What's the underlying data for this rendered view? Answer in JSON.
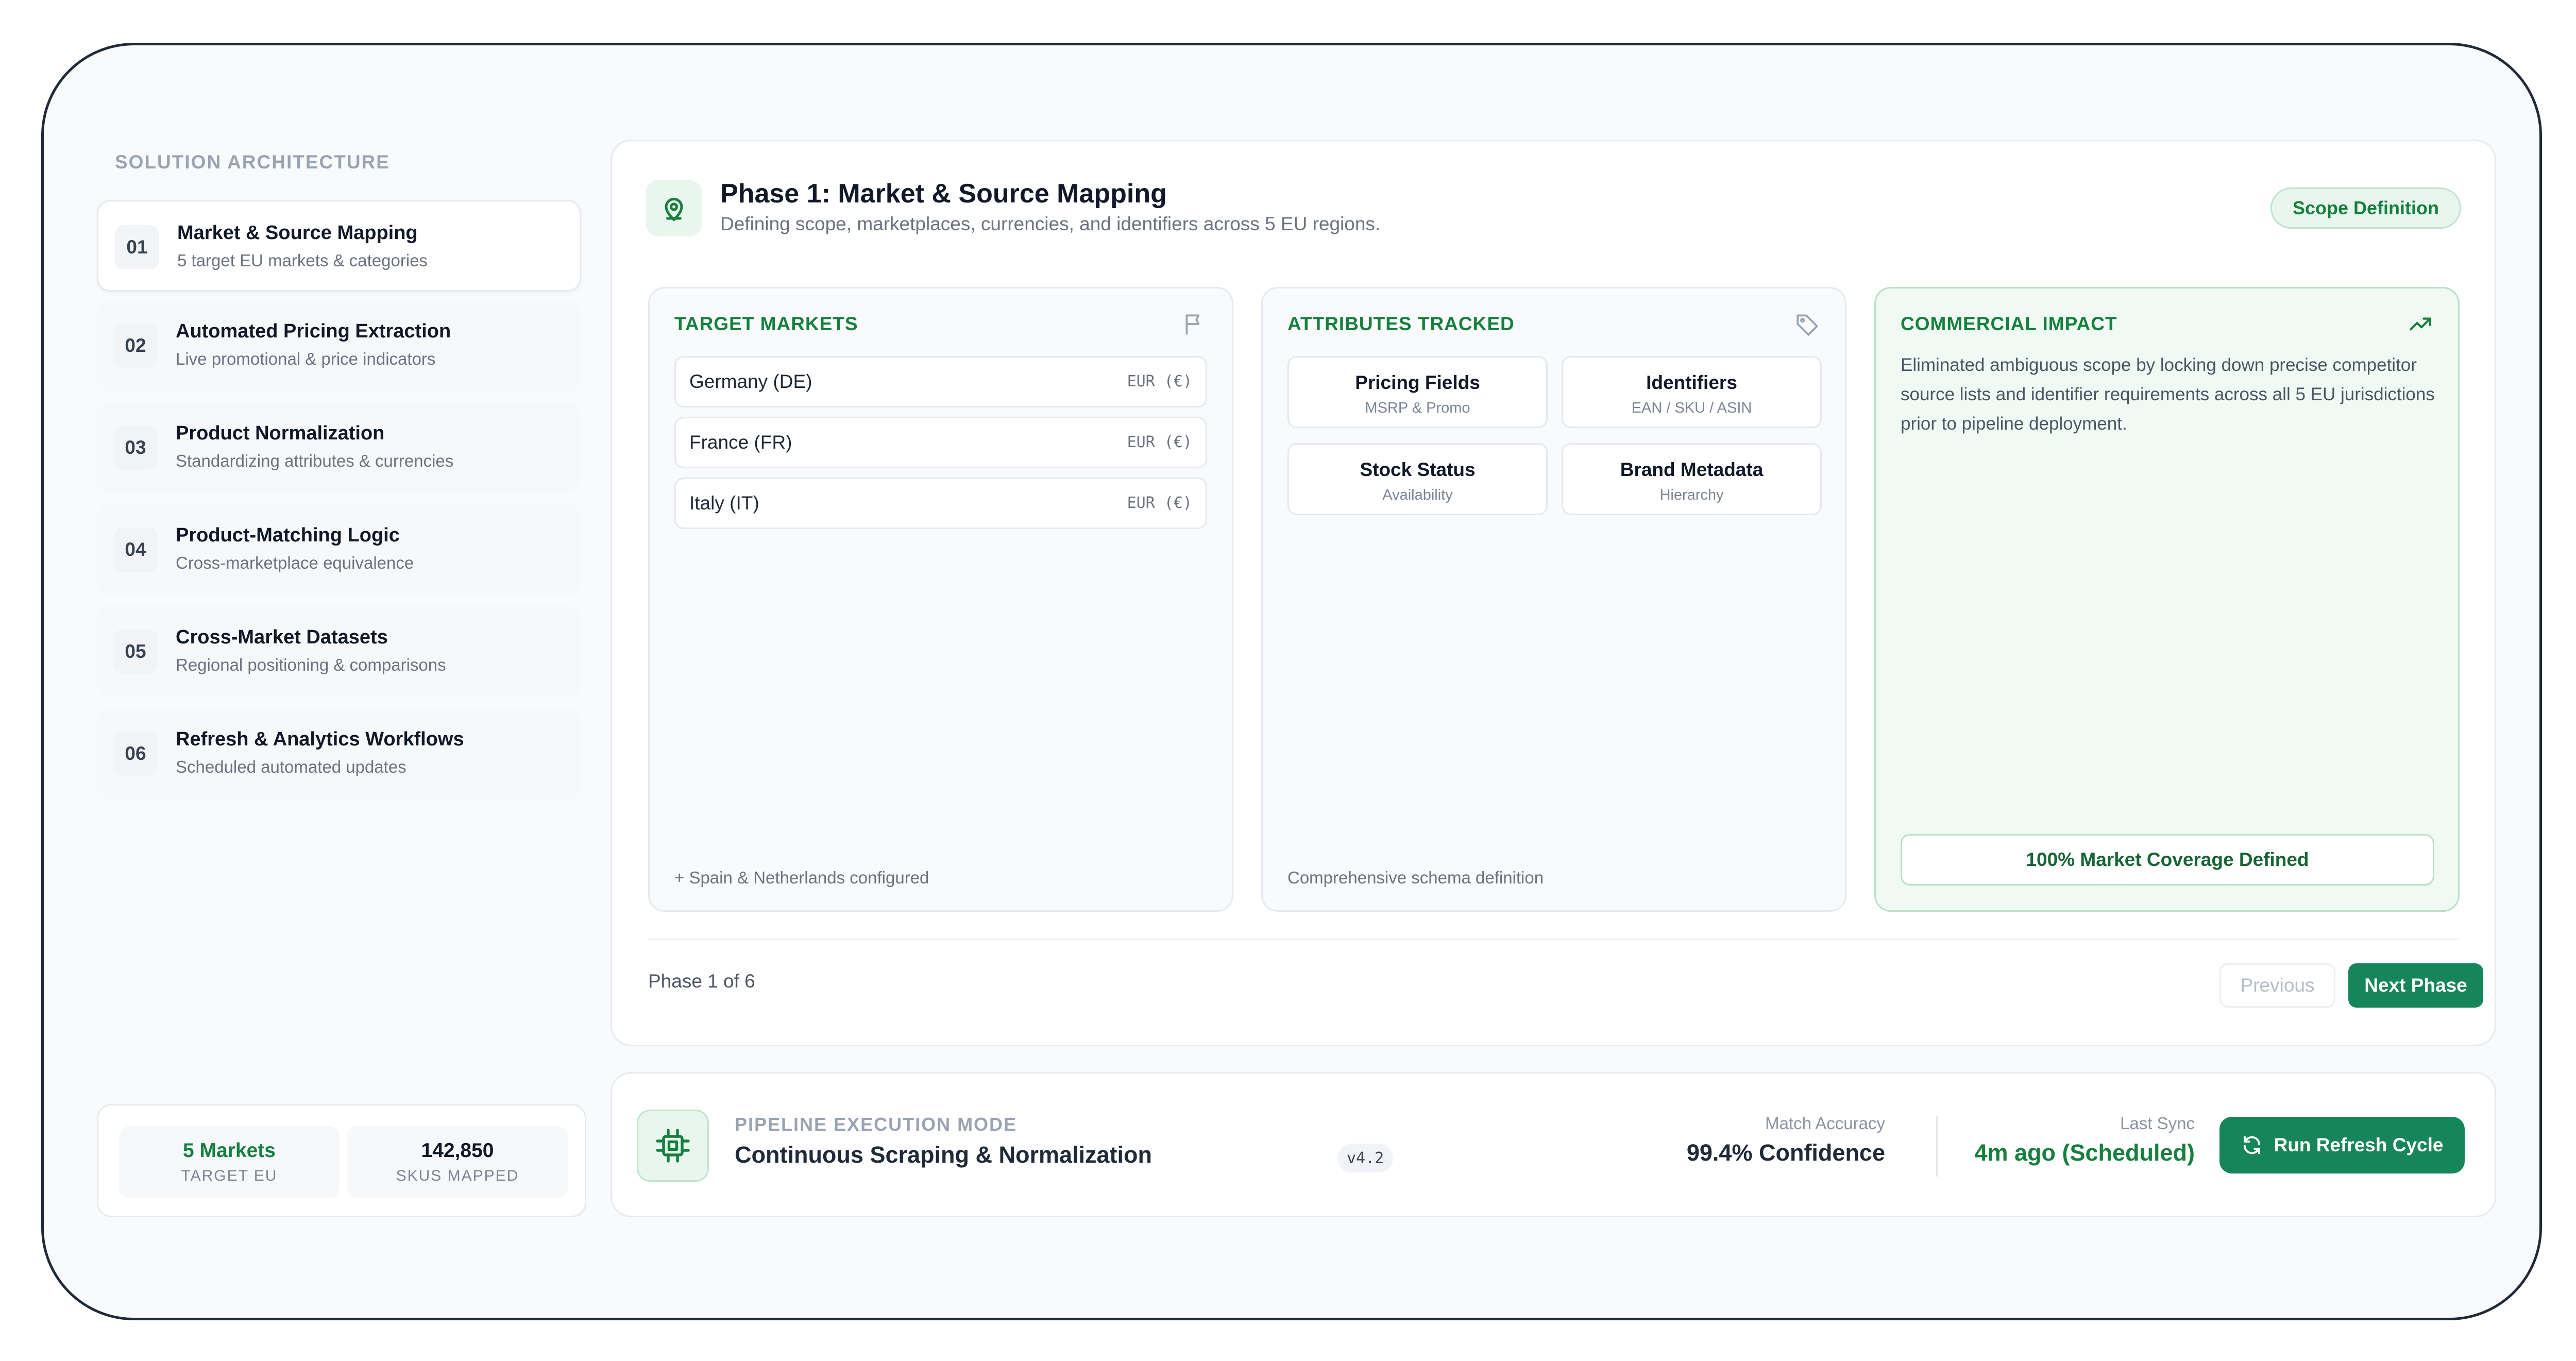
{
  "sidebar": {
    "heading": "SOLUTION ARCHITECTURE",
    "steps": [
      {
        "num": "01",
        "title": "Market & Source Mapping",
        "subtitle": "5 target EU markets & categories"
      },
      {
        "num": "02",
        "title": "Automated Pricing Extraction",
        "subtitle": "Live promotional & price indicators"
      },
      {
        "num": "03",
        "title": "Product Normalization",
        "subtitle": "Standardizing attributes & currencies"
      },
      {
        "num": "04",
        "title": "Product-Matching Logic",
        "subtitle": "Cross-marketplace equivalence"
      },
      {
        "num": "05",
        "title": "Cross-Market Datasets",
        "subtitle": "Regional positioning & comparisons"
      },
      {
        "num": "06",
        "title": "Refresh & Analytics Workflows",
        "subtitle": "Scheduled automated updates"
      }
    ],
    "stats": [
      {
        "value": "5 Markets",
        "label": "TARGET EU"
      },
      {
        "value": "142,850",
        "label": "SKUS MAPPED"
      }
    ]
  },
  "phase": {
    "title": "Phase 1: Market & Source Mapping",
    "subtitle": "Defining scope, marketplaces, currencies, and identifiers across 5 EU regions.",
    "badge": "Scope Definition",
    "counter": "Phase 1 of 6",
    "prev_label": "Previous",
    "next_label": "Next Phase"
  },
  "markets": {
    "title": "TARGET MARKETS",
    "rows": [
      {
        "name": "Germany (DE)",
        "currency": "EUR (€)"
      },
      {
        "name": "France (FR)",
        "currency": "EUR (€)"
      },
      {
        "name": "Italy (IT)",
        "currency": "EUR (€)"
      }
    ],
    "footer": "+ Spain & Netherlands configured"
  },
  "attributes": {
    "title": "ATTRIBUTES TRACKED",
    "items": [
      {
        "title": "Pricing Fields",
        "subtitle": "MSRP & Promo"
      },
      {
        "title": "Identifiers",
        "subtitle": "EAN / SKU / ASIN"
      },
      {
        "title": "Stock Status",
        "subtitle": "Availability"
      },
      {
        "title": "Brand Metadata",
        "subtitle": "Hierarchy"
      }
    ],
    "footer": "Comprehensive schema definition"
  },
  "impact": {
    "title": "COMMERCIAL IMPACT",
    "text": "Eliminated ambiguous scope by locking down precise competitor source lists and identifier requirements across all 5 EU jurisdictions prior to pipeline deployment.",
    "coverage": "100% Market Coverage Defined"
  },
  "pipeline": {
    "label": "PIPELINE EXECUTION MODE",
    "mode": "Continuous Scraping & Normalization",
    "version": "v4.2",
    "accuracy_label": "Match Accuracy",
    "accuracy_value": "99.4% Confidence",
    "sync_label": "Last Sync",
    "sync_value": "4m ago (Scheduled)",
    "run_label": "Run Refresh Cycle"
  },
  "colors": {
    "accent": "#16855a",
    "accent_text": "#15803d",
    "accent_soft": "#e9f6ee"
  }
}
